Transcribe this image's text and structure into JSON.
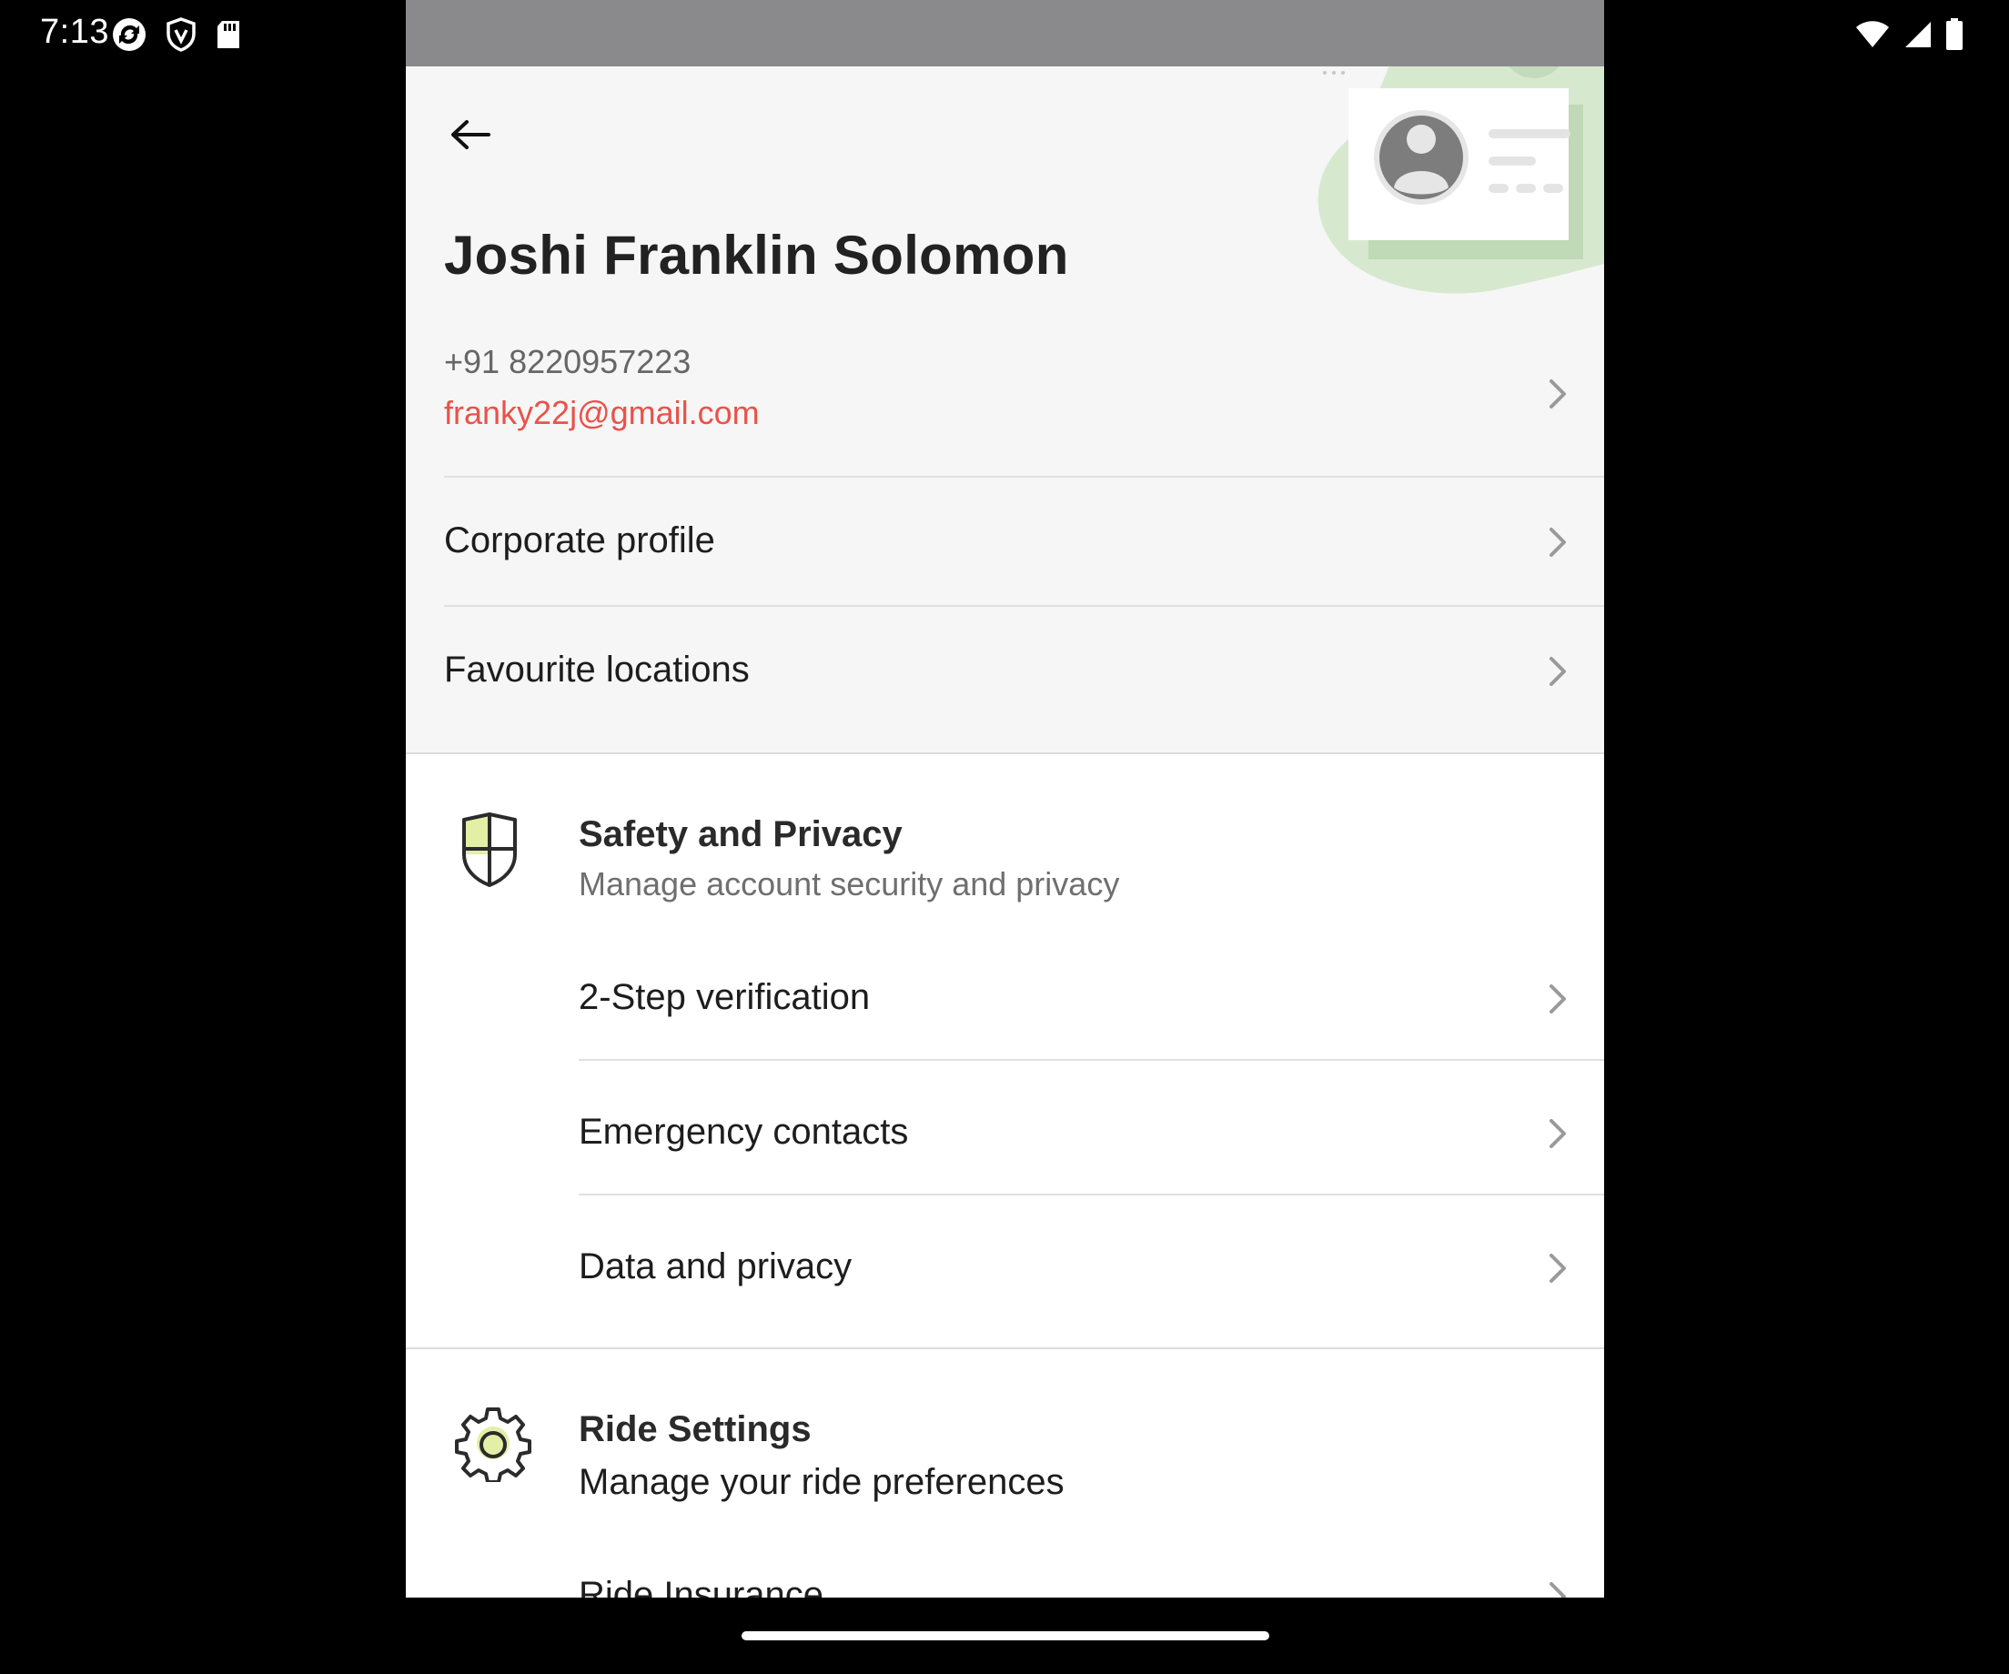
{
  "status_bar": {
    "time": "7:13",
    "left_icons": [
      "sync-icon",
      "vpn-shield-icon",
      "sd-card-icon"
    ],
    "right_icons": [
      "wifi-icon",
      "cell-signal-icon",
      "battery-icon"
    ]
  },
  "header": {
    "back_icon": "arrow-left-icon",
    "name": "Joshi Franklin Solomon",
    "phone": "+91 8220957223",
    "email": "franky22j@gmail.com",
    "illustration": "profile-card-illustration"
  },
  "menu": [
    {
      "label": "Corporate profile"
    },
    {
      "label": "Favourite locations"
    }
  ],
  "sections": [
    {
      "icon": "shield-icon",
      "title": "Safety and Privacy",
      "subtitle": "Manage account security and privacy",
      "items": [
        {
          "label": "2-Step verification"
        },
        {
          "label": "Emergency contacts"
        },
        {
          "label": "Data and privacy"
        }
      ]
    },
    {
      "icon": "gear-icon",
      "title": "Ride Settings",
      "subtitle": "Manage your ride preferences",
      "items": [
        {
          "label": "Ride Insurance"
        }
      ]
    }
  ],
  "colors": {
    "accent_email": "#e8534a",
    "illustration_green": "#cfe5c7",
    "icon_highlight": "#e3efa6"
  }
}
